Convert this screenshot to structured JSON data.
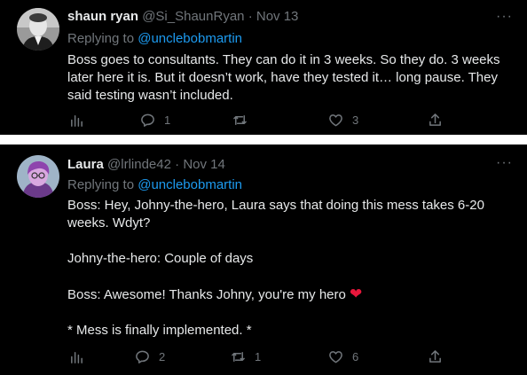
{
  "tweets": [
    {
      "name": "shaun ryan",
      "handle": "@Si_ShaunRyan",
      "separator": "·",
      "date": "Nov 13",
      "reply_prefix": "Replying to ",
      "reply_mention": "@unclebobmartin",
      "body": "Boss goes to consultants. They can do it in 3 weeks. So they do. 3 weeks later here it is. But it doesn’t work, have they tested it… long pause. They said testing wasn’t included.",
      "more": "···",
      "counts": {
        "replies": "1",
        "retweets": "",
        "likes": "3"
      }
    },
    {
      "name": "Laura",
      "handle": "@lrlinde42",
      "separator": "·",
      "date": "Nov 14",
      "reply_prefix": "Replying to ",
      "reply_mention": "@unclebobmartin",
      "body_lines": [
        "Boss: Hey, Johny-the-hero, Laura says that doing this mess takes 6-20 weeks. Wdyt?",
        "Johny-the-hero: Couple of days",
        "Boss: Awesome! Thanks Johny, you're my hero",
        "* Mess is finally implemented. *"
      ],
      "emoji": "❤",
      "more": "···",
      "counts": {
        "replies": "2",
        "retweets": "1",
        "likes": "6"
      }
    }
  ],
  "icons": [
    "analytics-icon",
    "reply-icon",
    "retweet-icon",
    "like-icon",
    "share-icon"
  ],
  "colors": {
    "background": "#000000",
    "text": "#e7e9ea",
    "muted": "#71767b",
    "link": "#1d9bf0",
    "heart": "#e8173b"
  }
}
